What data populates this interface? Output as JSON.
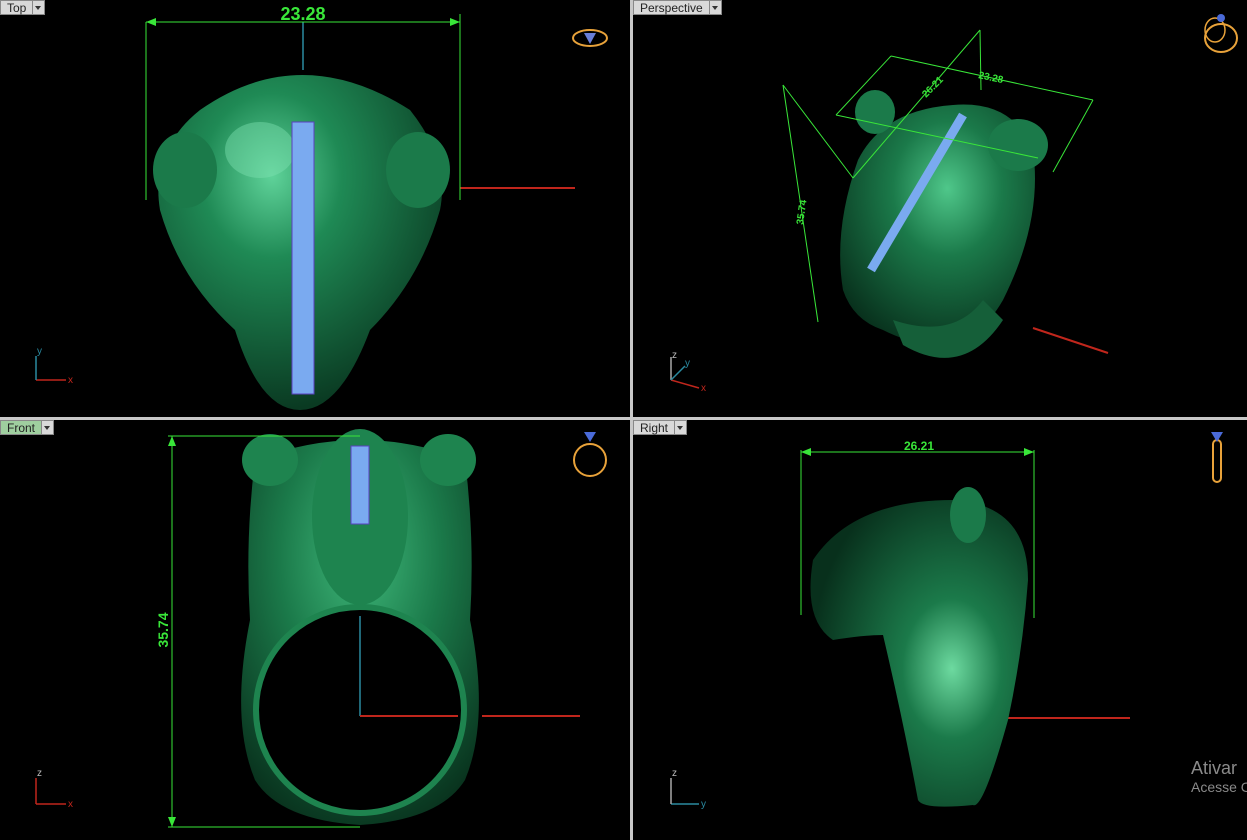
{
  "viewports": {
    "top": {
      "label": "Top",
      "dimension": "23.28",
      "axis_x": "x",
      "axis_y": "y"
    },
    "perspective": {
      "label": "Perspective",
      "dim_a": "26.21",
      "dim_b": "23.28",
      "dim_c": "35.74",
      "axis_x": "x",
      "axis_y": "y",
      "axis_z": "z"
    },
    "front": {
      "label": "Front",
      "dimension": "35.74",
      "axis_x": "x",
      "axis_z": "z"
    },
    "right": {
      "label": "Right",
      "dimension": "26.21",
      "axis_y": "y",
      "axis_z": "z"
    }
  },
  "watermark": {
    "line1": "Ativar",
    "line2": "Acesse C"
  },
  "colors": {
    "model": "#1e7a4c",
    "gem": "#7aaaf0",
    "dimension": "#39e639",
    "axis_red": "#c0261c",
    "axis_blue": "#2a8aa0",
    "view_icon": "#e8a23a"
  },
  "icons": {
    "top_view": "ring-top-view-icon",
    "perspective_view": "ring-perspective-view-icon",
    "front_view": "ring-front-view-icon",
    "right_view": "ring-side-view-icon"
  }
}
